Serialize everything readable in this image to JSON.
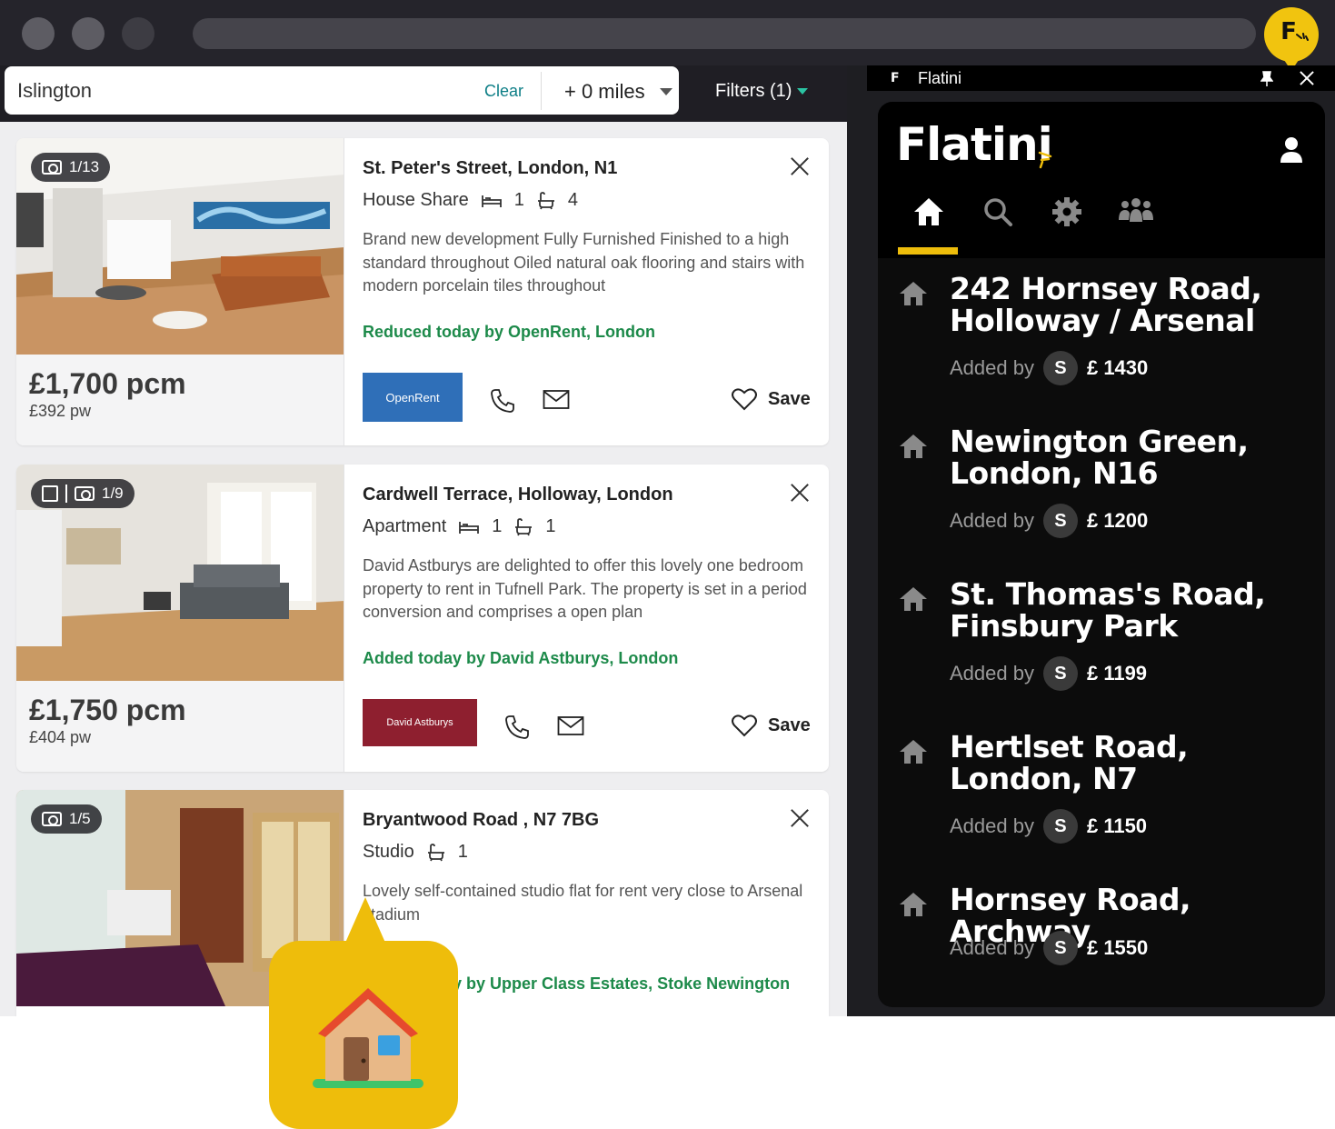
{
  "search": {
    "query": "Islington",
    "clear_label": "Clear",
    "radius_label": "+ 0 miles",
    "filters_label": "Filters (1)"
  },
  "listings": [
    {
      "photo_count": "1/13",
      "price": "£1,700 pcm",
      "price_weekly": "£392 pw",
      "address": "St. Peter's Street, London, N1",
      "type": "House Share",
      "beds": "1",
      "baths": "4",
      "description": "Brand new development Fully Furnished Finished to a high standard throughout Oiled natural oak flooring and stairs with modern porcelain tiles throughout",
      "added_text": "Reduced today by OpenRent, London",
      "agent_logo": "OpenRent",
      "save_label": "Save"
    },
    {
      "photo_count": "1/9",
      "price": "£1,750 pcm",
      "price_weekly": "£404 pw",
      "address": "Cardwell Terrace, Holloway, London",
      "type": "Apartment",
      "beds": "1",
      "baths": "1",
      "description": "David Astburys are delighted to offer this lovely one bedroom property to rent in Tufnell Park. The property is set in a period conversion and comprises a open plan",
      "added_text": "Added today by David Astburys, London",
      "agent_logo": "David Astburys",
      "save_label": "Save"
    },
    {
      "photo_count": "1/5",
      "address": "Bryantwood Road , N7 7BG",
      "type": "Studio",
      "baths": "1",
      "description": "Lovely self-contained studio flat for rent very close to Arsenal stadium",
      "added_text": "Added today by Upper Class Estates, Stoke Newington"
    }
  ],
  "extension": {
    "window_title": "Flatini",
    "brand": "Flatini",
    "nav_icons": [
      "home-icon",
      "search-icon",
      "gear-icon",
      "group-icon"
    ],
    "accent_color": "#eebd0b",
    "saved": [
      {
        "title": "242 Hornsey Road, Holloway / Arsenal",
        "added_by_label": "Added by",
        "avatar": "S",
        "price": "£ 1430"
      },
      {
        "title": "Newington Green, London, N16",
        "added_by_label": "Added by",
        "avatar": "S",
        "price": "£ 1200"
      },
      {
        "title": "St. Thomas's Road, Finsbury Park",
        "added_by_label": "Added by",
        "avatar": "S",
        "price": "£ 1199"
      },
      {
        "title": "Hertlset Road, London, N7",
        "added_by_label": "Added by",
        "avatar": "S",
        "price": "£ 1150"
      },
      {
        "title": "Hornsey Road, Archway",
        "added_by_label": "Added by",
        "avatar": "S",
        "price": "£ 1550"
      }
    ]
  },
  "extension_button": {
    "letter": "F"
  },
  "brand_colors": {
    "link_teal": "#0d7e86",
    "added_green": "#1d8a4a"
  }
}
